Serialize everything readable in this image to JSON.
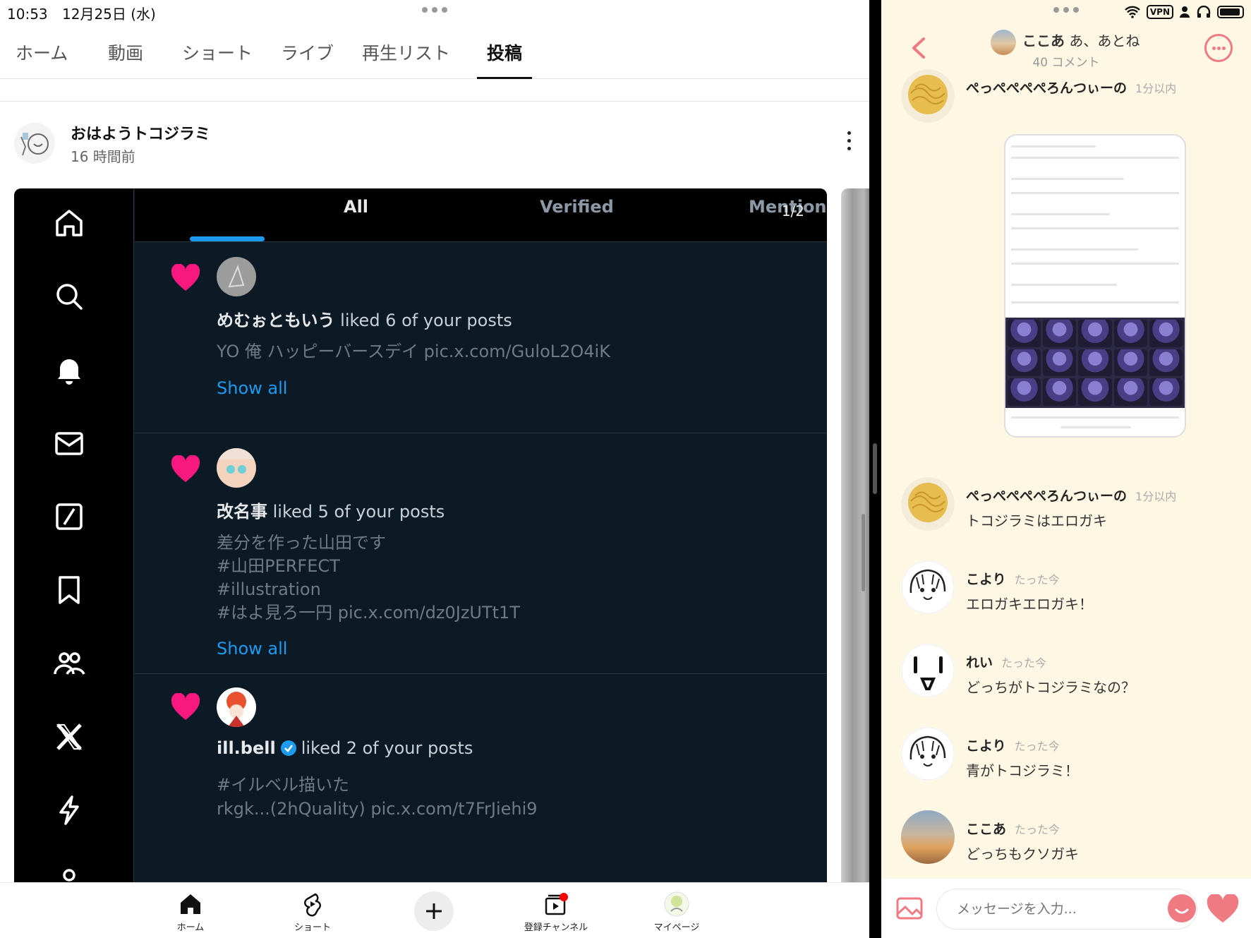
{
  "status_left": {
    "time": "10:53",
    "date": "12月25日 (水)"
  },
  "status_right": {
    "vpn": "VPN"
  },
  "tabs": [
    "ホーム",
    "動画",
    "ショート",
    "ライブ",
    "再生リスト",
    "投稿"
  ],
  "post": {
    "channel": "おはようトコジラミ",
    "time": "16 時間前"
  },
  "x": {
    "tabs": [
      "All",
      "Verified",
      "Mentions"
    ],
    "page": "1/2",
    "items": [
      {
        "name": "めむぉともいう",
        "action": "liked 6 of your posts",
        "text": [
          "YO 俺 ハッピーバースデイ pic.x.com/GuloL2O4iK"
        ],
        "show": "Show all"
      },
      {
        "name": "改名事",
        "action": "liked 5 of your posts",
        "text": [
          "差分を作った山田です",
          "#山田PERFECT",
          "#illustration",
          "#はよ見ろ一円 pic.x.com/dz0JzUTt1T"
        ],
        "show": "Show all"
      },
      {
        "name": "ill.bell",
        "action": "liked 2 of your posts",
        "text": [
          "#イルベル描いた",
          "rkgk...(2hQuality) pic.x.com/t7FrJiehi9"
        ],
        "verified": true
      }
    ]
  },
  "bottom_nav": [
    "ホーム",
    "ショート",
    "登録チャンネル",
    "マイページ"
  ],
  "chat": {
    "title_bold": "ここあ",
    "title_rest": "あ、あとね",
    "subtitle": "40 コメント",
    "messages": [
      {
        "name": "ぺっぺぺぺぺろんつぃーの",
        "time": "1分以内",
        "text": ""
      },
      {
        "name": "ぺっぺぺぺぺろんつぃーの",
        "time": "1分以内",
        "text": "トコジラミはエロガキ"
      },
      {
        "name": "こより",
        "time": "たった今",
        "text": "エロガキエロガキ！"
      },
      {
        "name": "れい",
        "time": "たった今",
        "text": "どっちがトコジラミなの？"
      },
      {
        "name": "こより",
        "time": "たった今",
        "text": "青がトコジラミ！"
      },
      {
        "name": "ここあ",
        "time": "たった今",
        "text": "どっちもクソガキ"
      }
    ],
    "input_placeholder": "メッセージを入力..."
  },
  "colors": {
    "accent_pink": "#f07a82",
    "x_blue": "#1d9bf0",
    "heart": "#f91880",
    "chat_bg": "#fdf7e4"
  }
}
